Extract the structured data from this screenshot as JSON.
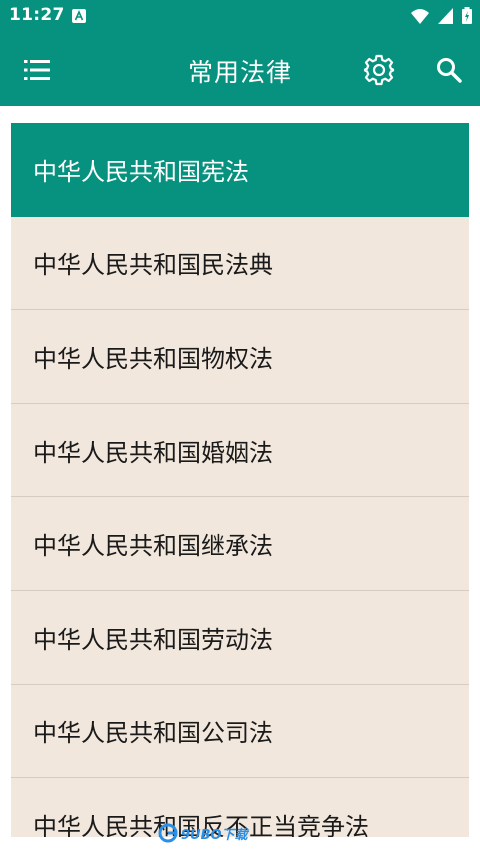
{
  "status_bar": {
    "time": "11:27",
    "icons": [
      "a-notification-icon",
      "wifi-icon",
      "signal-icon",
      "battery-charging-icon"
    ]
  },
  "app_bar": {
    "title": "常用法律",
    "menu_icon": "list-menu-icon",
    "settings_icon": "gear-icon",
    "search_icon": "search-icon"
  },
  "colors": {
    "primary": "#07927f",
    "list_background": "#f1e7dc",
    "divider": "#d6ccc1",
    "text": "#1a1a1a"
  },
  "laws": [
    {
      "label": "中华人民共和国宪法",
      "selected": true
    },
    {
      "label": "中华人民共和国民法典",
      "selected": false
    },
    {
      "label": "中华人民共和国物权法",
      "selected": false
    },
    {
      "label": "中华人民共和国婚姻法",
      "selected": false
    },
    {
      "label": "中华人民共和国继承法",
      "selected": false
    },
    {
      "label": "中华人民共和国劳动法",
      "selected": false
    },
    {
      "label": "中华人民共和国公司法",
      "selected": false
    },
    {
      "label": "中华人民共和国反不正当竞争法",
      "selected": false
    }
  ],
  "watermark": {
    "text": "9UBO下载"
  }
}
